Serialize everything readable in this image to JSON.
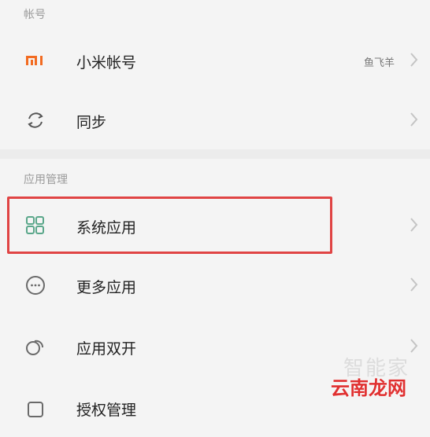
{
  "sections": {
    "account_label": "帐号",
    "app_management_label": "应用管理"
  },
  "items": [
    {
      "label": "小米帐号",
      "value": "鱼飞羊",
      "icon": "mi-logo-icon"
    },
    {
      "label": "同步",
      "icon": "sync-icon"
    },
    {
      "label": "系统应用",
      "icon": "grid-apps-icon",
      "highlighted": true
    },
    {
      "label": "更多应用",
      "icon": "more-circle-icon"
    },
    {
      "label": "应用双开",
      "icon": "dual-app-icon"
    },
    {
      "label": "授权管理",
      "icon": "authorization-icon"
    }
  ],
  "colors": {
    "background": "#f4f4f4",
    "mi_orange": "#f26b21",
    "highlight_red": "#e04444",
    "grid_green": "#5aa78a"
  },
  "watermark": {
    "top_text": "智能家",
    "brand_text": "云南龙网"
  }
}
